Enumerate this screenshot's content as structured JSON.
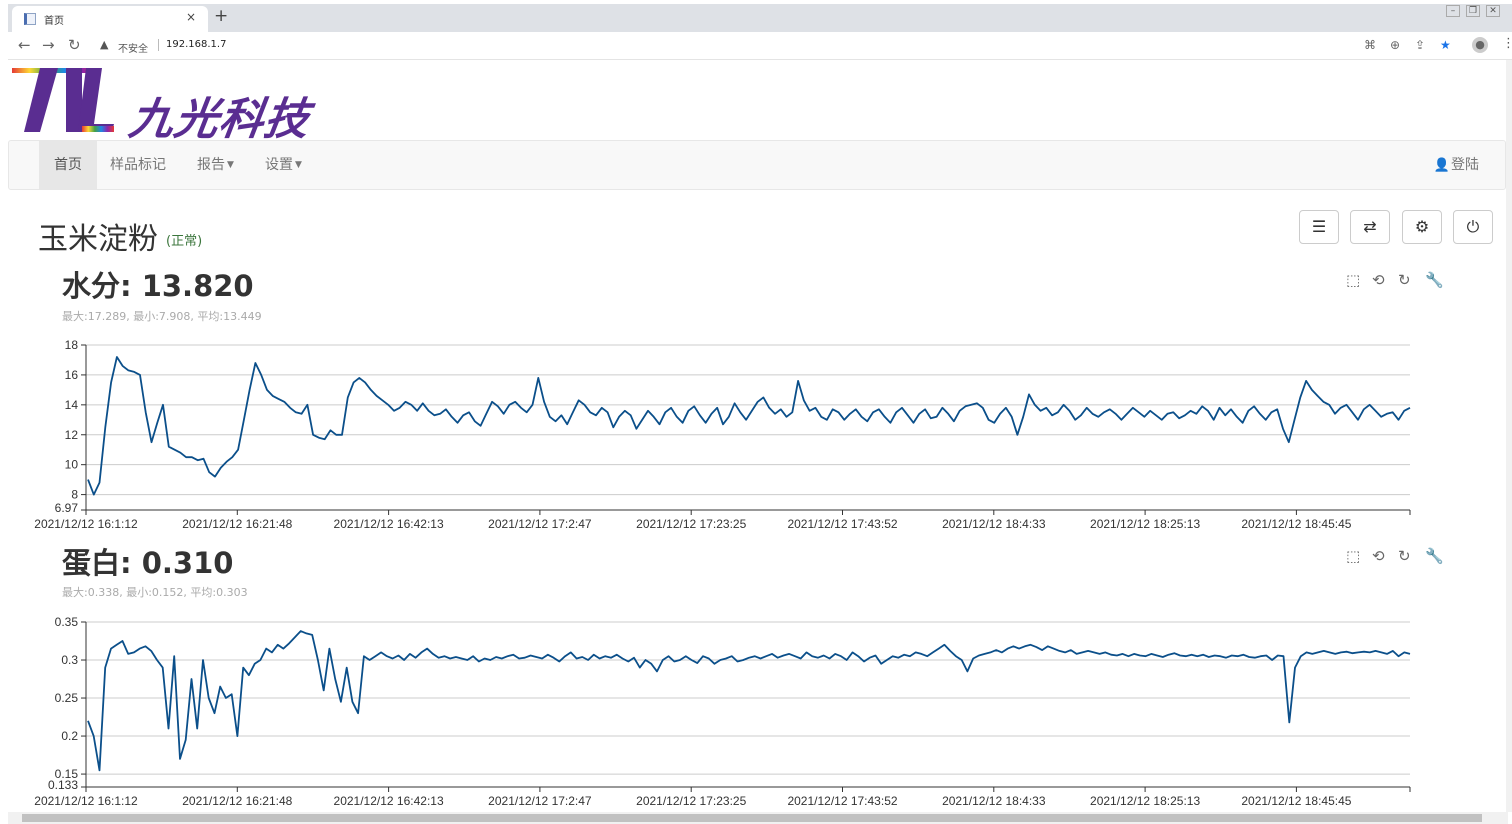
{
  "browser": {
    "tab_title": "首页",
    "close_glyph": "×",
    "new_tab_glyph": "+",
    "insecure_label": "不安全",
    "url": "192.168.1.7"
  },
  "logo": {
    "text": "九光科技",
    "mark": "NL"
  },
  "nav": {
    "items": [
      {
        "label": "首页",
        "active": true
      },
      {
        "label": "样品标记",
        "active": false
      },
      {
        "label": "报告",
        "active": false,
        "dropdown": true
      },
      {
        "label": "设置",
        "active": false,
        "dropdown": true
      }
    ],
    "login_label": "登陆"
  },
  "sample": {
    "name": "玉米淀粉",
    "status": "(正常)"
  },
  "actions": [
    "list-icon",
    "swap-icon",
    "gear-icon",
    "power-icon"
  ],
  "charts": [
    {
      "title": "水分: 13.820",
      "stats": "最大:17.289, 最小:7.908, 平均:13.449"
    },
    {
      "title": "蛋白: 0.310",
      "stats": "最大:0.338, 最小:0.152, 平均:0.303"
    }
  ],
  "chart_data": [
    {
      "type": "line",
      "series": [
        {
          "color": "#0b4f8a"
        }
      ],
      "ylim": [
        6.97,
        18
      ],
      "yticks": [
        "18",
        "16",
        "14",
        "12",
        "10",
        "8",
        "6.97"
      ],
      "xticks": [
        "2021/12/12 16:1:12",
        "2021/12/12 16:21:48",
        "2021/12/12 16:42:13",
        "2021/12/12 17:2:47",
        "2021/12/12 17:23:25",
        "2021/12/12 17:43:52",
        "2021/12/12 18:4:33",
        "2021/12/12 18:25:13",
        "2021/12/12 18:45:45"
      ],
      "grid": true,
      "values": [
        9.0,
        8.0,
        8.8,
        12.5,
        15.5,
        17.2,
        16.6,
        16.3,
        16.2,
        16.0,
        13.5,
        11.5,
        12.8,
        14.0,
        11.2,
        11.0,
        10.8,
        10.5,
        10.5,
        10.3,
        10.4,
        9.5,
        9.2,
        9.8,
        10.2,
        10.5,
        11.0,
        13.0,
        15.0,
        16.8,
        16.0,
        15.0,
        14.6,
        14.4,
        14.2,
        13.8,
        13.5,
        13.4,
        14.0,
        12.0,
        11.8,
        11.7,
        12.3,
        12.0,
        12.0,
        14.5,
        15.5,
        15.8,
        15.5,
        15.0,
        14.6,
        14.3,
        14.0,
        13.6,
        13.8,
        14.2,
        14.0,
        13.6,
        14.1,
        13.6,
        13.3,
        13.4,
        13.7,
        13.2,
        12.8,
        13.3,
        13.5,
        12.9,
        12.6,
        13.4,
        14.2,
        13.9,
        13.4,
        14.0,
        14.2,
        13.8,
        13.5,
        14.0,
        15.8,
        14.2,
        13.2,
        12.9,
        13.3,
        12.7,
        13.5,
        14.3,
        14.0,
        13.5,
        13.3,
        13.8,
        13.5,
        12.5,
        13.2,
        13.6,
        13.3,
        12.4,
        13.0,
        13.6,
        13.2,
        12.7,
        13.5,
        13.8,
        13.2,
        12.8,
        13.6,
        13.9,
        13.3,
        12.8,
        13.4,
        13.8,
        12.7,
        13.2,
        14.1,
        13.5,
        13.0,
        13.6,
        14.2,
        14.5,
        13.8,
        13.4,
        13.7,
        13.2,
        13.5,
        15.6,
        14.3,
        13.6,
        13.8,
        13.2,
        13.0,
        13.7,
        13.5,
        13.0,
        13.4,
        13.7,
        13.2,
        12.9,
        13.5,
        13.7,
        13.2,
        12.8,
        13.5,
        13.8,
        13.3,
        12.8,
        13.4,
        13.7,
        13.1,
        13.2,
        13.8,
        13.4,
        12.9,
        13.6,
        13.9,
        14.0,
        14.1,
        13.8,
        13.0,
        12.8,
        13.4,
        13.8,
        13.2,
        12.0,
        13.2,
        14.7,
        14.0,
        13.6,
        13.8,
        13.3,
        13.5,
        14.0,
        13.6,
        13.0,
        13.3,
        13.8,
        13.4,
        13.2,
        13.5,
        13.7,
        13.4,
        13.0,
        13.4,
        13.8,
        13.5,
        13.2,
        13.6,
        13.3,
        13.0,
        13.4,
        13.5,
        13.1,
        13.3,
        13.6,
        13.4,
        13.9,
        13.6,
        13.0,
        13.8,
        13.3,
        13.7,
        13.2,
        12.8,
        13.6,
        13.9,
        13.4,
        13.0,
        13.5,
        13.7,
        12.4,
        11.5,
        13.0,
        14.5,
        15.6,
        15.0,
        14.6,
        14.2,
        14.0,
        13.4,
        13.8,
        14.0,
        13.5,
        13.0,
        13.7,
        14.0,
        13.6,
        13.2,
        13.4,
        13.5,
        13.0,
        13.6,
        13.8
      ]
    },
    {
      "type": "line",
      "series": [
        {
          "color": "#0b4f8a"
        }
      ],
      "ylim": [
        0.133,
        0.35
      ],
      "yticks": [
        "0.35",
        "0.3",
        "0.25",
        "0.2",
        "0.15",
        "0.133"
      ],
      "xticks": [
        "2021/12/12 16:1:12",
        "2021/12/12 16:21:48",
        "2021/12/12 16:42:13",
        "2021/12/12 17:2:47",
        "2021/12/12 17:23:25",
        "2021/12/12 17:43:52",
        "2021/12/12 18:4:33",
        "2021/12/12 18:25:13",
        "2021/12/12 18:45:45"
      ],
      "grid": true,
      "values": [
        0.22,
        0.2,
        0.155,
        0.29,
        0.315,
        0.32,
        0.325,
        0.308,
        0.31,
        0.315,
        0.318,
        0.312,
        0.3,
        0.29,
        0.21,
        0.305,
        0.17,
        0.195,
        0.275,
        0.21,
        0.3,
        0.25,
        0.23,
        0.265,
        0.25,
        0.255,
        0.2,
        0.29,
        0.28,
        0.295,
        0.3,
        0.315,
        0.31,
        0.32,
        0.315,
        0.322,
        0.33,
        0.338,
        0.335,
        0.333,
        0.3,
        0.26,
        0.315,
        0.275,
        0.245,
        0.29,
        0.245,
        0.23,
        0.305,
        0.3,
        0.305,
        0.31,
        0.305,
        0.302,
        0.306,
        0.3,
        0.308,
        0.303,
        0.31,
        0.315,
        0.308,
        0.303,
        0.305,
        0.302,
        0.304,
        0.302,
        0.3,
        0.305,
        0.298,
        0.302,
        0.3,
        0.304,
        0.302,
        0.305,
        0.307,
        0.302,
        0.303,
        0.306,
        0.304,
        0.302,
        0.307,
        0.303,
        0.298,
        0.305,
        0.31,
        0.302,
        0.304,
        0.3,
        0.307,
        0.302,
        0.305,
        0.303,
        0.307,
        0.302,
        0.298,
        0.303,
        0.29,
        0.3,
        0.295,
        0.285,
        0.3,
        0.305,
        0.298,
        0.3,
        0.305,
        0.3,
        0.296,
        0.305,
        0.302,
        0.295,
        0.3,
        0.302,
        0.305,
        0.298,
        0.3,
        0.303,
        0.305,
        0.302,
        0.305,
        0.308,
        0.303,
        0.306,
        0.308,
        0.305,
        0.302,
        0.31,
        0.305,
        0.303,
        0.306,
        0.302,
        0.308,
        0.305,
        0.3,
        0.31,
        0.305,
        0.298,
        0.303,
        0.306,
        0.295,
        0.3,
        0.305,
        0.303,
        0.307,
        0.305,
        0.31,
        0.308,
        0.305,
        0.31,
        0.315,
        0.32,
        0.312,
        0.305,
        0.3,
        0.285,
        0.302,
        0.306,
        0.308,
        0.31,
        0.313,
        0.31,
        0.315,
        0.318,
        0.315,
        0.318,
        0.32,
        0.317,
        0.313,
        0.318,
        0.315,
        0.312,
        0.31,
        0.313,
        0.308,
        0.31,
        0.312,
        0.31,
        0.308,
        0.31,
        0.307,
        0.306,
        0.308,
        0.305,
        0.308,
        0.306,
        0.305,
        0.308,
        0.306,
        0.304,
        0.307,
        0.309,
        0.306,
        0.305,
        0.307,
        0.305,
        0.307,
        0.304,
        0.306,
        0.305,
        0.303,
        0.306,
        0.305,
        0.307,
        0.304,
        0.303,
        0.305,
        0.306,
        0.3,
        0.306,
        0.305,
        0.218,
        0.29,
        0.305,
        0.31,
        0.308,
        0.31,
        0.312,
        0.31,
        0.308,
        0.31,
        0.311,
        0.309,
        0.31,
        0.311,
        0.31,
        0.312,
        0.31,
        0.308,
        0.312,
        0.305,
        0.31,
        0.308
      ]
    }
  ]
}
